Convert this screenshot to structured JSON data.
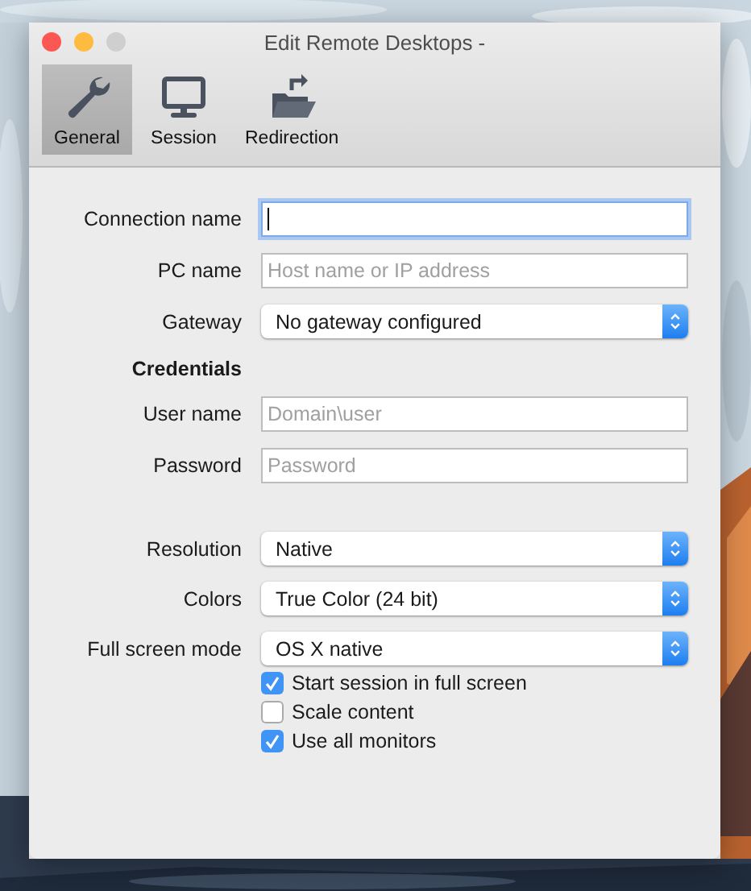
{
  "window": {
    "title": "Edit Remote Desktops -"
  },
  "toolbar": [
    {
      "label": "General",
      "selected": true
    },
    {
      "label": "Session",
      "selected": false
    },
    {
      "label": "Redirection",
      "selected": false
    }
  ],
  "form": [
    {
      "kind": "text",
      "label": "Connection name",
      "focused": true
    },
    {
      "kind": "text",
      "label": "PC name",
      "placeholder": "Host name or IP address",
      "focused": false
    },
    {
      "kind": "select",
      "label": "Gateway",
      "value": "No gateway configured"
    },
    {
      "kind": "heading",
      "label": "Credentials"
    },
    {
      "kind": "text",
      "label": "User name",
      "placeholder": "Domain\\user",
      "focused": false
    },
    {
      "kind": "text",
      "label": "Password",
      "placeholder": "Password",
      "focused": false
    },
    {
      "kind": "spacer"
    },
    {
      "kind": "select",
      "label": "Resolution",
      "value": "Native"
    },
    {
      "kind": "select",
      "label": "Colors",
      "value": "True Color (24 bit)"
    },
    {
      "kind": "select",
      "label": "Full screen mode",
      "value": "OS X native"
    }
  ],
  "checkboxes": [
    {
      "label": "Start session in full screen",
      "checked": true
    },
    {
      "label": "Scale content",
      "checked": false
    },
    {
      "label": "Use all monitors",
      "checked": true
    }
  ]
}
